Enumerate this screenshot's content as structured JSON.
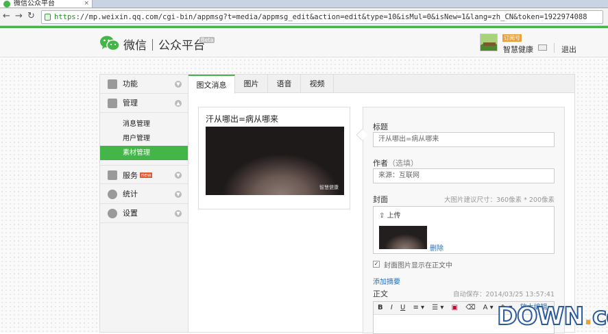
{
  "browser": {
    "tab_title": "微信公众平台",
    "close_glyph": "×",
    "url_scheme": "https",
    "url_rest": "://mp.weixin.qq.com/cgi-bin/appmsg?t=media/appmsg_edit&action=edit&type=10&isMul=0&isNew=1&lang=zh_CN&token=1922974088",
    "nav": {
      "back": "←",
      "forward": "→",
      "reload": "↻"
    }
  },
  "header": {
    "brand": "微信｜公众平台",
    "beta": "Beta",
    "account_badge": "订阅号",
    "account_name": "智慧健康",
    "logout": "退出"
  },
  "sidebar": {
    "items": [
      {
        "label": "功能",
        "icon": "grid-icon"
      },
      {
        "label": "管理",
        "icon": "inbox-icon"
      },
      {
        "label": "服务",
        "icon": "printer-icon",
        "tag": "new"
      },
      {
        "label": "统计",
        "icon": "pie-icon"
      },
      {
        "label": "设置",
        "icon": "gear-icon"
      }
    ],
    "sub_items": [
      {
        "label": "消息管理"
      },
      {
        "label": "用户管理"
      },
      {
        "label": "素材管理"
      }
    ]
  },
  "tabs": [
    {
      "label": "图文消息"
    },
    {
      "label": "图片"
    },
    {
      "label": "语音"
    },
    {
      "label": "视频"
    }
  ],
  "preview": {
    "title": "汗从哪出=病从哪来",
    "watermark": "智慧健康"
  },
  "form": {
    "title_label": "标题",
    "title_value": "汗从哪出=病从哪来",
    "author_label": "作者",
    "author_hint": "（选填）",
    "author_value": "来源：互联网",
    "cover_label": "封面",
    "cover_note": "大图片建议尺寸：360像素 * 200像素",
    "upload_label": "上传",
    "delete_label": "删除",
    "show_cover_label": "封面图片显示在正文中",
    "show_cover_checked": true,
    "add_summary": "添加摘要",
    "body_label": "正文",
    "autosave": "自动保存：2014/03/25 13:57:41",
    "toolbar": [
      "B",
      "I",
      "U",
      "≡ ▾",
      "☰ ▾",
      "▣",
      "⌫",
      "A ▾",
      "✎ ▾",
      "放大编辑"
    ]
  },
  "watermark_site": {
    "left": "DOWN",
    "dot": ".",
    "right": "cc"
  },
  "colors": {
    "accent": "#44b549",
    "link": "#2a6fb8"
  }
}
